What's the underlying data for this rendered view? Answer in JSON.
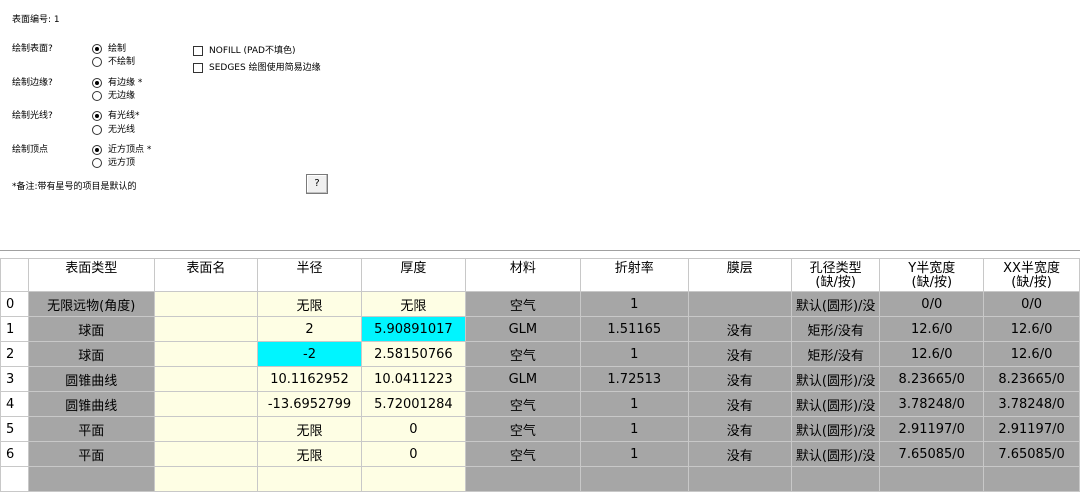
{
  "surface_number_label": "表面编号: 1",
  "options": [
    {
      "label": "绘制表面?",
      "choices": [
        {
          "text": "绘制",
          "selected": true
        },
        {
          "text": "不绘制",
          "selected": false
        }
      ]
    },
    {
      "label": "绘制边缘?",
      "choices": [
        {
          "text": "有边缘 *",
          "selected": true
        },
        {
          "text": "无边缘",
          "selected": false
        }
      ]
    },
    {
      "label": "绘制光线?",
      "choices": [
        {
          "text": "有光线*",
          "selected": true
        },
        {
          "text": "无光线",
          "selected": false
        }
      ]
    },
    {
      "label": "绘制顶点",
      "choices": [
        {
          "text": "近方顶点 *",
          "selected": true
        },
        {
          "text": "远方顶",
          "selected": false
        }
      ]
    }
  ],
  "checkboxes": [
    {
      "text": "NOFILL (PAD不填色)",
      "checked": false
    },
    {
      "text": "SEDGES 绘图使用简易边缘",
      "checked": false
    }
  ],
  "note": "*备注:带有星号的项目是默认的",
  "help_label": "?",
  "table": {
    "headers": [
      "",
      "表面类型",
      "表面名",
      "半径",
      "厚度",
      "材料",
      "折射率",
      "膜层",
      "孔径类型",
      "Y半宽度",
      "XX半宽度"
    ],
    "header_sub": [
      "(缺/按)",
      "(缺/按)",
      "(缺/按)"
    ],
    "rows": [
      [
        "0",
        "无限远物(角度)",
        "",
        "无限",
        "无限",
        "空气",
        "1",
        "",
        "默认(圆形)/没",
        "0/0",
        "0/0"
      ],
      [
        "1",
        "球面",
        "",
        "2",
        "5.90891017",
        "GLM",
        "1.51165",
        "没有",
        "矩形/没有",
        "12.6/0",
        "12.6/0"
      ],
      [
        "2",
        "球面",
        "",
        "-2",
        "2.58150766",
        "空气",
        "1",
        "没有",
        "矩形/没有",
        "12.6/0",
        "12.6/0"
      ],
      [
        "3",
        "圆锥曲线",
        "",
        "10.1162952",
        "10.0411223",
        "GLM",
        "1.72513",
        "没有",
        "默认(圆形)/没",
        "8.23665/0",
        "8.23665/0"
      ],
      [
        "4",
        "圆锥曲线",
        "",
        "-13.6952799",
        "5.72001284",
        "空气",
        "1",
        "没有",
        "默认(圆形)/没",
        "3.78248/0",
        "3.78248/0"
      ],
      [
        "5",
        "平面",
        "",
        "无限",
        "0",
        "空气",
        "1",
        "没有",
        "默认(圆形)/没",
        "2.91197/0",
        "2.91197/0"
      ],
      [
        "6",
        "平面",
        "",
        "无限",
        "0",
        "空气",
        "1",
        "没有",
        "默认(圆形)/没",
        "7.65085/0",
        "7.65085/0"
      ],
      [
        "",
        "",
        "",
        "",
        "",
        "",
        "",
        "",
        "",
        "",
        ""
      ]
    ]
  },
  "colors": {
    "gray_cell": "#a6a6a6",
    "yellow_cell": "#fefee4",
    "highlight": "#00f5ff"
  }
}
